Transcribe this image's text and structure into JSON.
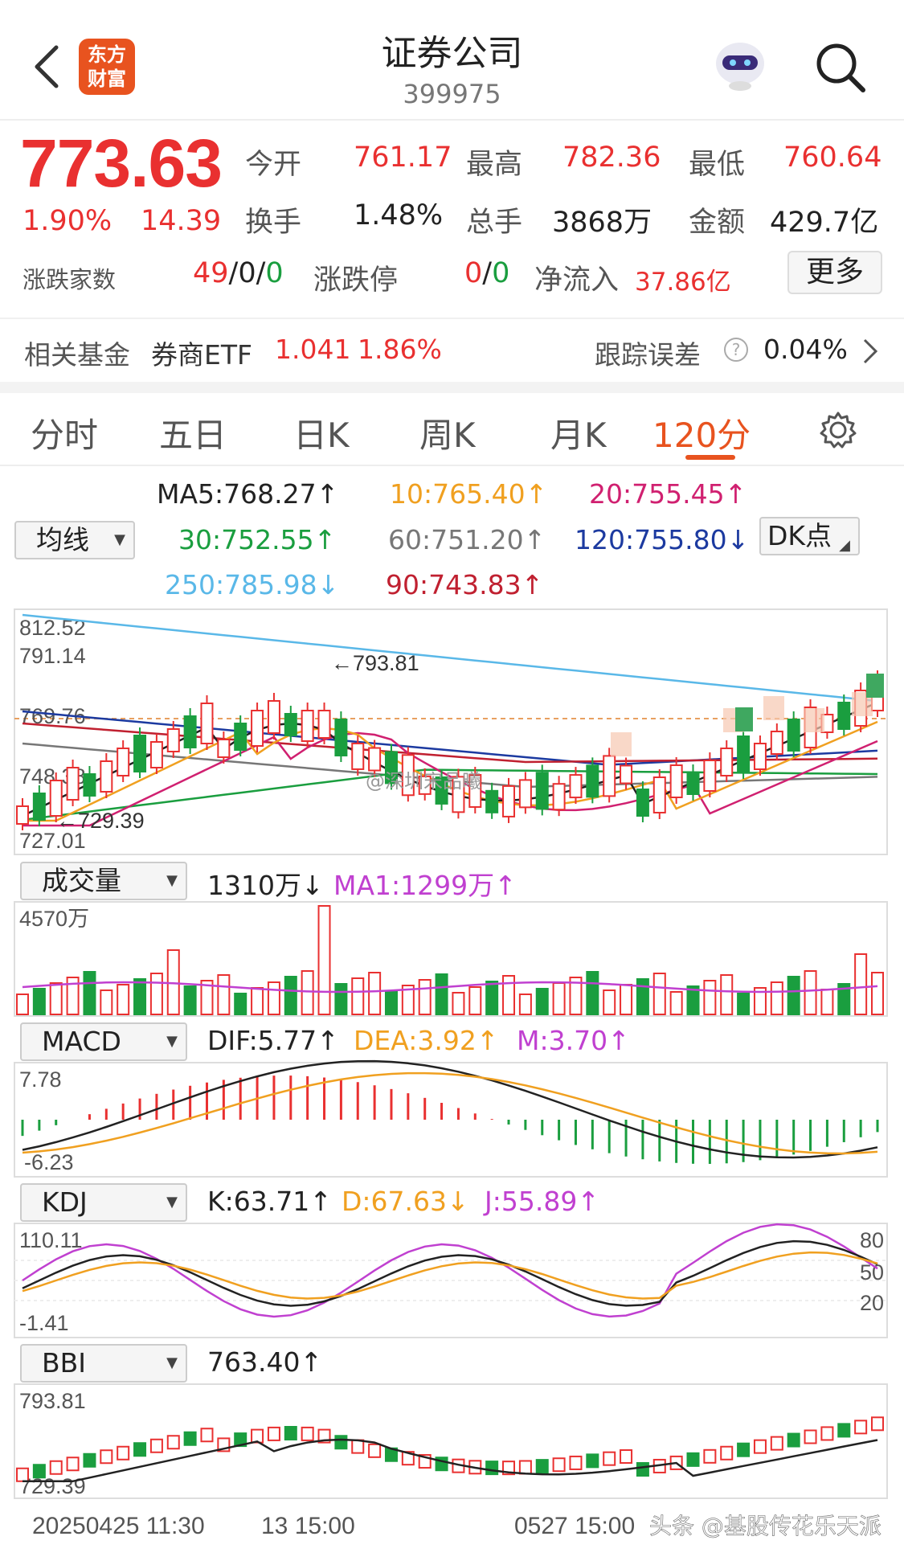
{
  "header": {
    "logo_line1": "东方",
    "logo_line2": "财富",
    "title": "证券公司",
    "code": "399975"
  },
  "quote": {
    "price": "773.63",
    "change_pct": "1.90%",
    "change": "14.39",
    "open_label": "今开",
    "open": "761.17",
    "high_label": "最高",
    "high": "782.36",
    "low_label": "最低",
    "low": "760.64",
    "turnover_label": "换手",
    "turnover": "1.48%",
    "volume_label": "总手",
    "volume": "3868万",
    "amount_label": "金额",
    "amount": "429.7亿",
    "updown_label": "涨跌家数",
    "up_count": "49",
    "flat_sep1": "/0/",
    "down_count": "0",
    "limit_label": "涨跌停",
    "limit_up": "0",
    "limit_sep": "/",
    "limit_down": "0",
    "netflow_label": "净流入",
    "netflow": "37.86亿",
    "more_label": "更多"
  },
  "fund": {
    "label": "相关基金",
    "name": "券商ETF",
    "price": "1.041",
    "pct": "1.86%",
    "error_label": "跟踪误差",
    "error": "0.04%"
  },
  "tabs": [
    {
      "label": "分时"
    },
    {
      "label": "五日"
    },
    {
      "label": "日K"
    },
    {
      "label": "周K"
    },
    {
      "label": "月K"
    },
    {
      "label": "120分"
    }
  ],
  "ma": {
    "selector": "均线",
    "ma5": "MA5:768.27↑",
    "ma10": "10:765.40↑",
    "ma20": "20:755.45↑",
    "ma30": "30:752.55↑",
    "ma60": "60:751.20↑",
    "ma120": "120:755.80↓",
    "ma250": "250:785.98↓",
    "ma90": "90:743.83↑",
    "dk_label": "DK点"
  },
  "kline": {
    "y_labels": [
      "812.52",
      "791.14",
      "769.76",
      "748.38",
      "727.01"
    ],
    "peak_label": "←793.81",
    "low_label": "←729.39",
    "watermark": "@深圳宋品曦"
  },
  "volume": {
    "selector": "成交量",
    "value": "1310万↓",
    "ma1": "MA1:1299万↑",
    "max_label": "4570万"
  },
  "macd": {
    "selector": "MACD",
    "dif": "DIF:5.77↑",
    "dea": "DEA:3.92↑",
    "m": "M:3.70↑",
    "top": "7.78",
    "bottom": "-6.23"
  },
  "kdj": {
    "selector": "KDJ",
    "k": "K:63.71↑",
    "d": "D:67.63↓",
    "j": "J:55.89↑",
    "top": "110.11",
    "bottom": "-1.41",
    "r80": "80",
    "r50": "50",
    "r20": "20"
  },
  "bbi": {
    "selector": "BBI",
    "value": "763.40↑",
    "top": "793.81",
    "bottom": "729.39"
  },
  "xaxis": {
    "left": "20250425 11:30",
    "mid": "13 15:00",
    "right": "0527 15:00"
  },
  "footer_watermark": "头条 @基股传花乐天派",
  "colors": {
    "up": "#e93030",
    "down": "#1a9e3f",
    "accent": "#e8531f"
  }
}
